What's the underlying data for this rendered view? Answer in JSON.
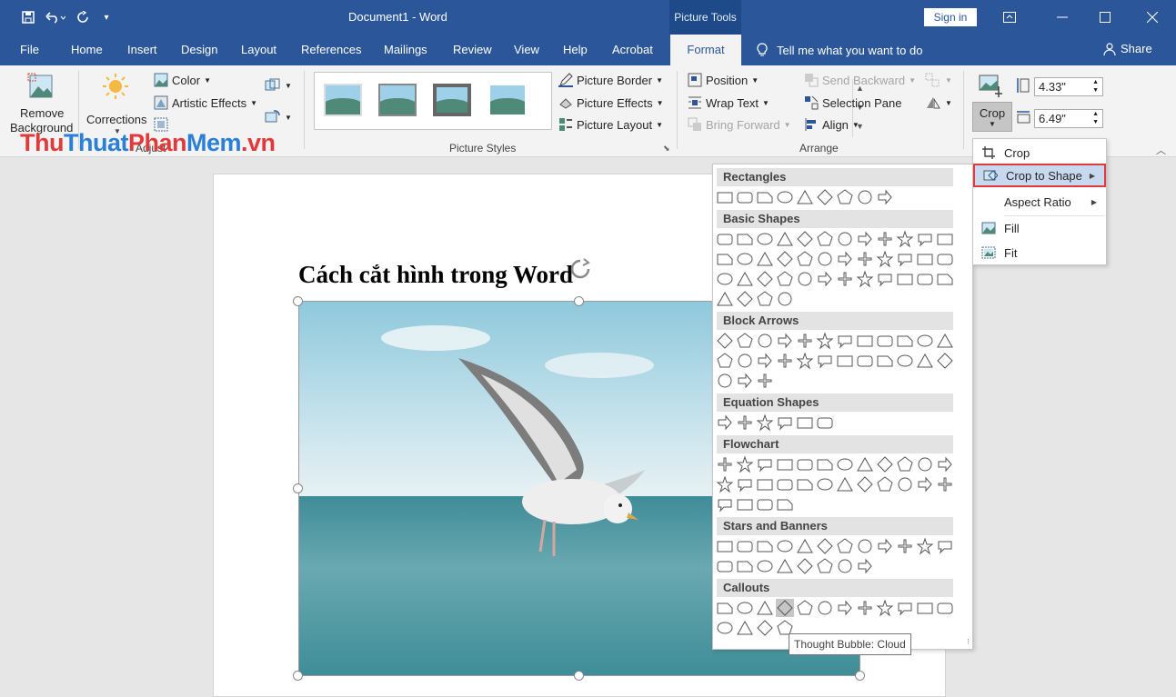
{
  "titlebar": {
    "doc_title": "Document1  -  Word",
    "context_tab_group": "Picture Tools",
    "sign_in": "Sign in"
  },
  "tabs": [
    "File",
    "Home",
    "Insert",
    "Design",
    "Layout",
    "References",
    "Mailings",
    "Review",
    "View",
    "Help",
    "Acrobat"
  ],
  "active_tab": "Format",
  "tell_me": "Tell me what you want to do",
  "share": "Share",
  "ribbon": {
    "remove_background_1": "Remove",
    "remove_background_2": "Background",
    "corrections": "Corrections",
    "color": "Color",
    "artistic_effects": "Artistic Effects",
    "group_adjust": "Adjust",
    "picture_border": "Picture Border",
    "picture_effects": "Picture Effects",
    "picture_layout": "Picture Layout",
    "group_picture_styles": "Picture Styles",
    "position": "Position",
    "wrap_text": "Wrap Text",
    "bring_forward": "Bring Forward",
    "send_backward": "Send Backward",
    "selection_pane": "Selection Pane",
    "align": "Align",
    "group_arrange": "Arrange",
    "crop": "Crop",
    "height": "4.33\"",
    "width": "6.49\""
  },
  "document": {
    "heading": "Cách cắt hình trong Word"
  },
  "shapes_panel": {
    "categories": [
      "Rectangles",
      "Basic Shapes",
      "Block Arrows",
      "Equation Shapes",
      "Flowchart",
      "Stars and Banners",
      "Callouts"
    ],
    "tooltip": "Thought Bubble: Cloud"
  },
  "crop_menu": {
    "items": [
      "Crop",
      "Crop to Shape",
      "Aspect Ratio",
      "Fill",
      "Fit"
    ]
  },
  "watermark": {
    "part1": "Thu",
    "part2": "Thuat",
    "part3": "Phan",
    "part4": "Mem",
    "part5": ".vn",
    "color_red": "#e03a3a",
    "color_blue": "#2b7fd6"
  }
}
